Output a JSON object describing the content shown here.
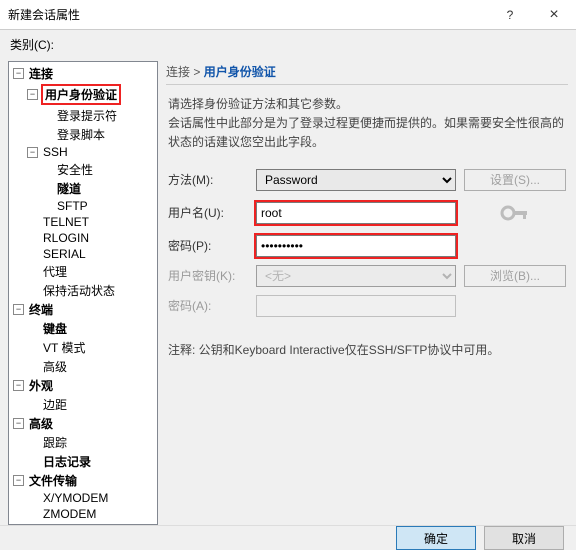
{
  "window": {
    "title": "新建会话属性",
    "help_icon": "?",
    "close_icon": "×"
  },
  "category_label": "类别(C):",
  "tree": {
    "connect": "连接",
    "user_auth": "用户身份验证",
    "login_prompt": "登录提示符",
    "login_script": "登录脚本",
    "ssh": "SSH",
    "security": "安全性",
    "tunnel": "隧道",
    "sftp": "SFTP",
    "telnet": "TELNET",
    "rlogin": "RLOGIN",
    "serial": "SERIAL",
    "proxy": "代理",
    "keepalive": "保持活动状态",
    "terminal": "终端",
    "keyboard": "键盘",
    "vt": "VT 模式",
    "advanced_term": "高级",
    "appearance": "外观",
    "margin": "边距",
    "advanced": "高级",
    "trace": "跟踪",
    "logging": "日志记录",
    "filetransfer": "文件传输",
    "xymodem": "X/YMODEM",
    "zmodem": "ZMODEM"
  },
  "breadcrumb": {
    "root": "连接",
    "sep": " > ",
    "current": "用户身份验证"
  },
  "desc": {
    "line1": "请选择身份验证方法和其它参数。",
    "line2": "会话属性中此部分是为了登录过程更便捷而提供的。如果需要安全性很高的状态的话建议您空出此字段。"
  },
  "form": {
    "method_label": "方法(M):",
    "method_value": "Password",
    "setup_btn": "设置(S)...",
    "user_label": "用户名(U):",
    "user_value": "root",
    "pass_label": "密码(P):",
    "pass_value": "••••••••••",
    "userkey_label": "用户密钥(K):",
    "userkey_value": "<无>",
    "browse_btn": "浏览(B)...",
    "passA_label": "密码(A):"
  },
  "note": "注释: 公钥和Keyboard Interactive仅在SSH/SFTP协议中可用。",
  "footer": {
    "ok": "确定",
    "cancel": "取消"
  }
}
